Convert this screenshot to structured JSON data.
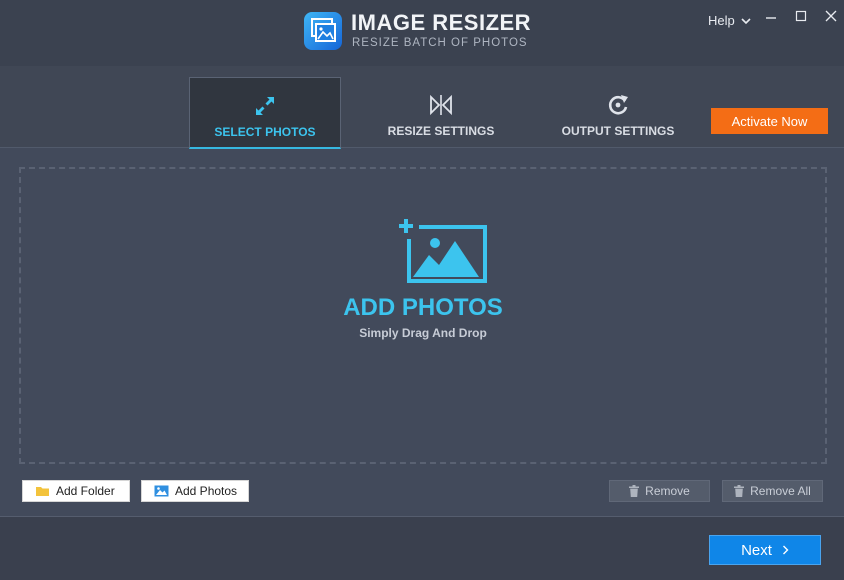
{
  "app": {
    "title": "IMAGE RESIZER",
    "subtitle": "RESIZE BATCH OF PHOTOS",
    "icon": "image-resizer-logo"
  },
  "window_controls": {
    "help_label": "Help",
    "help_icon": "chevron-down-icon",
    "minimize_icon": "minimize-icon",
    "maximize_icon": "maximize-icon",
    "close_icon": "close-icon"
  },
  "tabs": [
    {
      "label": "SELECT PHOTOS",
      "icon": "expand-arrows-icon",
      "active": true
    },
    {
      "label": "RESIZE SETTINGS",
      "icon": "resize-icon",
      "active": false
    },
    {
      "label": "OUTPUT SETTINGS",
      "icon": "refresh-icon",
      "active": false
    }
  ],
  "activate_button": {
    "label": "Activate Now",
    "color": "#f46d15"
  },
  "dropzone": {
    "icon": "add-photo-icon",
    "title": "ADD PHOTOS",
    "subtitle": "Simply Drag And Drop"
  },
  "actions": {
    "add_folder": {
      "label": "Add Folder",
      "icon": "folder-icon"
    },
    "add_photos": {
      "label": "Add Photos",
      "icon": "image-icon"
    },
    "remove": {
      "label": "Remove",
      "icon": "trash-icon"
    },
    "remove_all": {
      "label": "Remove All",
      "icon": "trash-icon"
    }
  },
  "footer": {
    "next_label": "Next",
    "next_icon": "chevron-right-icon"
  },
  "colors": {
    "accent": "#3cc4ee",
    "background": "#424a5b",
    "next_button": "#0f86e8"
  }
}
